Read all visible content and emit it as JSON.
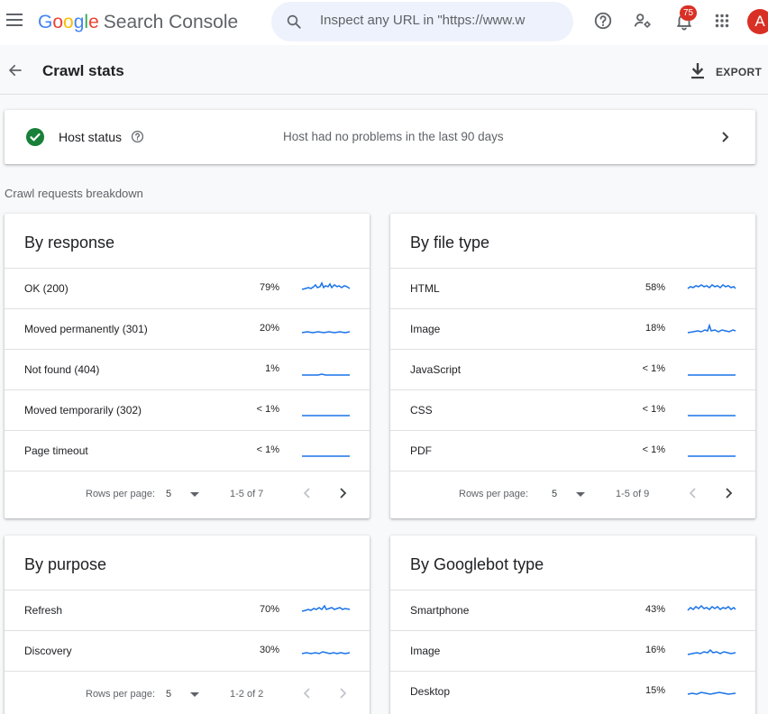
{
  "app": {
    "brand_letters": [
      "G",
      "o",
      "o",
      "g",
      "l",
      "e"
    ],
    "brand_suffix": "Search Console",
    "search_placeholder": "Inspect any URL in \"https://www.w",
    "notification_count": "75",
    "avatar_letter": "A"
  },
  "page": {
    "title": "Crawl stats",
    "export_label": "EXPORT"
  },
  "host_status": {
    "label": "Host status",
    "message": "Host had no problems in the last 90 days"
  },
  "section_label": "Crawl requests breakdown",
  "cards": {
    "response": {
      "title": "By response",
      "rows": [
        {
          "label": "OK (200)",
          "percent": "79%"
        },
        {
          "label": "Moved permanently (301)",
          "percent": "20%"
        },
        {
          "label": "Not found (404)",
          "percent": "1%"
        },
        {
          "label": "Moved temporarily (302)",
          "percent": "< 1%"
        },
        {
          "label": "Page timeout",
          "percent": "< 1%"
        }
      ],
      "pager": {
        "rows_label": "Rows per page:",
        "rows_value": "5",
        "range": "1-5 of 7"
      }
    },
    "file_type": {
      "title": "By file type",
      "rows": [
        {
          "label": "HTML",
          "percent": "58%"
        },
        {
          "label": "Image",
          "percent": "18%"
        },
        {
          "label": "JavaScript",
          "percent": "< 1%"
        },
        {
          "label": "CSS",
          "percent": "< 1%"
        },
        {
          "label": "PDF",
          "percent": "< 1%"
        }
      ],
      "pager": {
        "rows_label": "Rows per page:",
        "rows_value": "5",
        "range": "1-5 of 9"
      }
    },
    "purpose": {
      "title": "By purpose",
      "rows": [
        {
          "label": "Refresh",
          "percent": "70%"
        },
        {
          "label": "Discovery",
          "percent": "30%"
        }
      ],
      "pager": {
        "rows_label": "Rows per page:",
        "rows_value": "5",
        "range": "1-2 of 2"
      }
    },
    "googlebot": {
      "title": "By Googlebot type",
      "rows": [
        {
          "label": "Smartphone",
          "percent": "43%"
        },
        {
          "label": "Image",
          "percent": "16%"
        },
        {
          "label": "Desktop",
          "percent": "15%"
        }
      ]
    }
  },
  "colors": {
    "accent": "#1a73e8",
    "success": "#188038",
    "badge": "#d93025"
  }
}
